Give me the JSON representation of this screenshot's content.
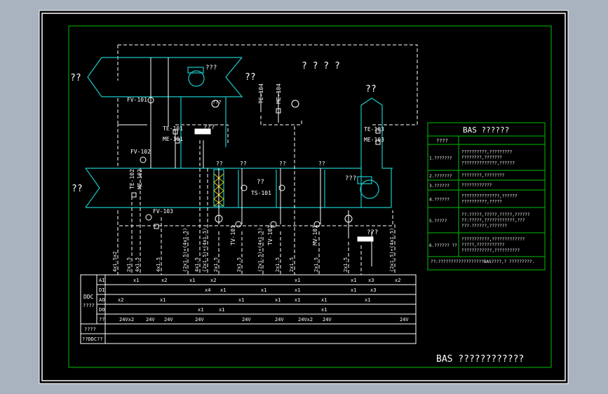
{
  "drawing": {
    "title_top": "? ? ? ?",
    "fresh_air_in": "??",
    "return_air": "??",
    "exhaust_air": "??",
    "supply_air": "??",
    "exhaust_fan": "???",
    "exhaust_damper": "??",
    "supply_fan": "???",
    "title_bottom": "BAS ????????????"
  },
  "tags": {
    "fv101": "FV-101",
    "fv102": "FV-102",
    "fv103": "FV-103",
    "te101": "TE-101",
    "me101": "ME-101",
    "te102": "TE-102",
    "me102": "ME-102",
    "te103": "TE-103",
    "me103": "ME-103",
    "te104": "TE-104",
    "me104": "ME-104",
    "tv101": "TV-101",
    "tv102": "TV-102",
    "ts101": "TS-101",
    "mv101": "MV-101",
    "filter1": "???",
    "filter2": "??",
    "coil1": "??",
    "coil2": "??",
    "coil_mark": "??",
    "humid": "??",
    "heater": "???",
    "fan_lbl": "???"
  },
  "cables": [
    "4x1.5x2",
    "2x1.5",
    "4x1.5",
    "4x1.5",
    "(2x1.5)+(4x1.5)",
    "4x1.5",
    "(2x1.5)+(4x1.5)",
    "2x1.5",
    "2x1.5",
    "(2x1.5)+(4x1.5)",
    "2x1.5",
    "2x1.5",
    "2x1.5",
    "2x1.5",
    "(2x1.5)+(4x1.5)"
  ],
  "ddc": {
    "label": "DDC",
    "label2": "????",
    "rows": [
      "AI",
      "DI",
      "AO",
      "DO",
      "??"
    ],
    "row_extra1": "????",
    "row_extra2": "??DDC??",
    "ai_marks": [
      "x1",
      "x1",
      "x2",
      "x1",
      "x1",
      "x3",
      "x2",
      "x2"
    ],
    "di_marks": [
      "x4",
      "x1",
      "x1",
      "x1",
      "x1",
      "x3"
    ],
    "ao_marks": [
      "x2",
      "x1",
      "x1",
      "x1",
      "x1",
      "x1",
      "x1"
    ],
    "do_marks": [
      "x1",
      "x1",
      "x1"
    ],
    "power": [
      "24Vx2",
      "24V",
      "24V",
      "24V",
      "24V",
      "24V",
      "24Vx2",
      "24V",
      "24V"
    ]
  },
  "legend": {
    "title": "BAS ??????",
    "header": "????",
    "items": [
      {
        "num": "1.???????",
        "text": "??????????,????????? ????????,??????? ??????????????,??????"
      },
      {
        "num": "2.???????",
        "text": "????????,????????"
      },
      {
        "num": "3.??????",
        "text": "????????????"
      },
      {
        "num": "4.??????",
        "text": "???????????????,?????? ??????????,?????"
      },
      {
        "num": "5.?????",
        "text": "??:?????,?????,?????,?????? ??:?????,????????????,??? ???-??????,???????"
      },
      {
        "num": "6.?????? ??",
        "text": "???????????,????????????? ?????,??????????? ????????????,??????????"
      }
    ],
    "note": "??:??????????????????BAS????,? ?????????."
  }
}
